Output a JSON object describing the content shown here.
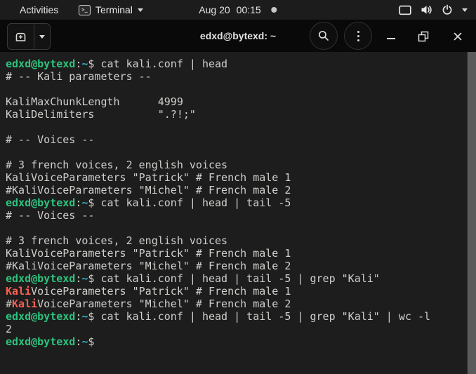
{
  "colors": {
    "terminal_bg": "#1D1D1D",
    "topbar_bg": "#1C1C1C",
    "header_bg": "#090909",
    "foreground": "#D0CFCC",
    "prompt_green": "#2EC27E",
    "path_cyan": "#35AEC2",
    "grep_match_red": "#F66151",
    "scrollbar_thumb": "#5B5B5B"
  },
  "topbar": {
    "activities": "Activities",
    "app_menu_label": "Terminal",
    "app_menu_icon": "terminal-icon",
    "clock_date": "Aug 20",
    "clock_time": "00:15",
    "notification_dot": true,
    "indicator_icons": [
      "screen-icon",
      "volume-icon",
      "power-icon",
      "chevron-down-icon"
    ]
  },
  "titlebar": {
    "title": "edxd@bytexd: ~",
    "buttons": [
      "new-tab",
      "new-tab-dropdown",
      "search",
      "menu",
      "minimize",
      "restore",
      "close"
    ]
  },
  "terminal": {
    "prompt": {
      "user_host": "edxd@bytexd",
      "path": "~"
    },
    "lines": [
      [
        {
          "t": "edxd@bytexd",
          "s": "g"
        },
        {
          "t": ":",
          "s": "f"
        },
        {
          "t": "~",
          "s": "c"
        },
        {
          "t": "$ cat kali.conf | head",
          "s": "f"
        }
      ],
      [
        {
          "t": "# -- Kali parameters --",
          "s": "f"
        }
      ],
      [],
      [
        {
          "t": "KaliMaxChunkLength      4999",
          "s": "f"
        }
      ],
      [
        {
          "t": "KaliDelimiters          \".?!;\"",
          "s": "f"
        }
      ],
      [],
      [
        {
          "t": "# -- Voices --",
          "s": "f"
        }
      ],
      [],
      [
        {
          "t": "# 3 french voices, 2 english voices",
          "s": "f"
        }
      ],
      [
        {
          "t": "KaliVoiceParameters \"Patrick\" # French male 1",
          "s": "f"
        }
      ],
      [
        {
          "t": "#KaliVoiceParameters \"Michel\" # French male 2",
          "s": "f"
        }
      ],
      [
        {
          "t": "edxd@bytexd",
          "s": "g"
        },
        {
          "t": ":",
          "s": "f"
        },
        {
          "t": "~",
          "s": "c"
        },
        {
          "t": "$ cat kali.conf | head | tail -5",
          "s": "f"
        }
      ],
      [
        {
          "t": "# -- Voices --",
          "s": "f"
        }
      ],
      [],
      [
        {
          "t": "# 3 french voices, 2 english voices",
          "s": "f"
        }
      ],
      [
        {
          "t": "KaliVoiceParameters \"Patrick\" # French male 1",
          "s": "f"
        }
      ],
      [
        {
          "t": "#KaliVoiceParameters \"Michel\" # French male 2",
          "s": "f"
        }
      ],
      [
        {
          "t": "edxd@bytexd",
          "s": "g"
        },
        {
          "t": ":",
          "s": "f"
        },
        {
          "t": "~",
          "s": "c"
        },
        {
          "t": "$ cat kali.conf | head | tail -5 | grep \"Kali\"",
          "s": "f"
        }
      ],
      [
        {
          "t": "Kali",
          "s": "r"
        },
        {
          "t": "VoiceParameters \"Patrick\" # French male 1",
          "s": "f"
        }
      ],
      [
        {
          "t": "#",
          "s": "f"
        },
        {
          "t": "Kali",
          "s": "r"
        },
        {
          "t": "VoiceParameters \"Michel\" # French male 2",
          "s": "f"
        }
      ],
      [
        {
          "t": "edxd@bytexd",
          "s": "g"
        },
        {
          "t": ":",
          "s": "f"
        },
        {
          "t": "~",
          "s": "c"
        },
        {
          "t": "$ cat kali.conf | head | tail -5 | grep \"Kali\" | wc -l",
          "s": "f"
        }
      ],
      [
        {
          "t": "2",
          "s": "f"
        }
      ],
      [
        {
          "t": "edxd@bytexd",
          "s": "g"
        },
        {
          "t": ":",
          "s": "f"
        },
        {
          "t": "~",
          "s": "c"
        },
        {
          "t": "$",
          "s": "f"
        }
      ]
    ]
  }
}
